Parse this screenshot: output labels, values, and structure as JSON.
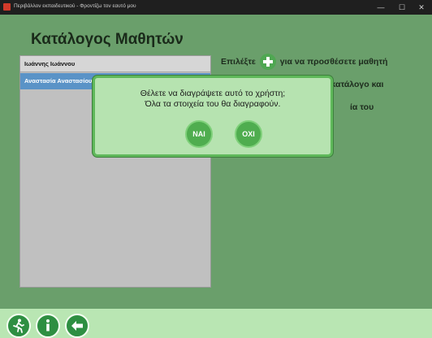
{
  "window": {
    "title": "Περιβάλλον εκπαιδευτικού - Φροντίζω τον εαυτό μου",
    "minimize_glyph": "—",
    "maximize_glyph": "☐",
    "close_glyph": "✕"
  },
  "page": {
    "title": "Κατάλογος Μαθητών"
  },
  "students": [
    {
      "name": "Ιωάννης Ιωάννου",
      "selected": false
    },
    {
      "name": "Αναστασία Αναστασίου",
      "selected": true
    }
  ],
  "instructions": {
    "line1_before": "Επιλέξτε",
    "line1_after": "για να προσθέσετε μαθητή",
    "line2": "ή επιλέξτε μαθητή από τον κατάλογο και",
    "line3_visible_fragment": "ία του",
    "add_icon": "plus-icon"
  },
  "dialog": {
    "message_line1": "Θέλετε να διαγράψετε αυτό το χρήστη;",
    "message_line2": "Όλα τα στοιχεία του θα διαγραφούν.",
    "yes_label": "ΝΑΙ",
    "no_label": "ΟΧΙ"
  },
  "bottom_bar": {
    "buttons": [
      "exit-icon",
      "info-icon",
      "back-arrow-icon"
    ]
  },
  "colors": {
    "background": "#6a9f6b",
    "dialog_bg": "#b6e3b0",
    "dialog_border": "#5fb85a",
    "selected_row": "#5a93c7",
    "button_green": "#4fad4f",
    "bottom_bar": "#b9e6b3"
  }
}
